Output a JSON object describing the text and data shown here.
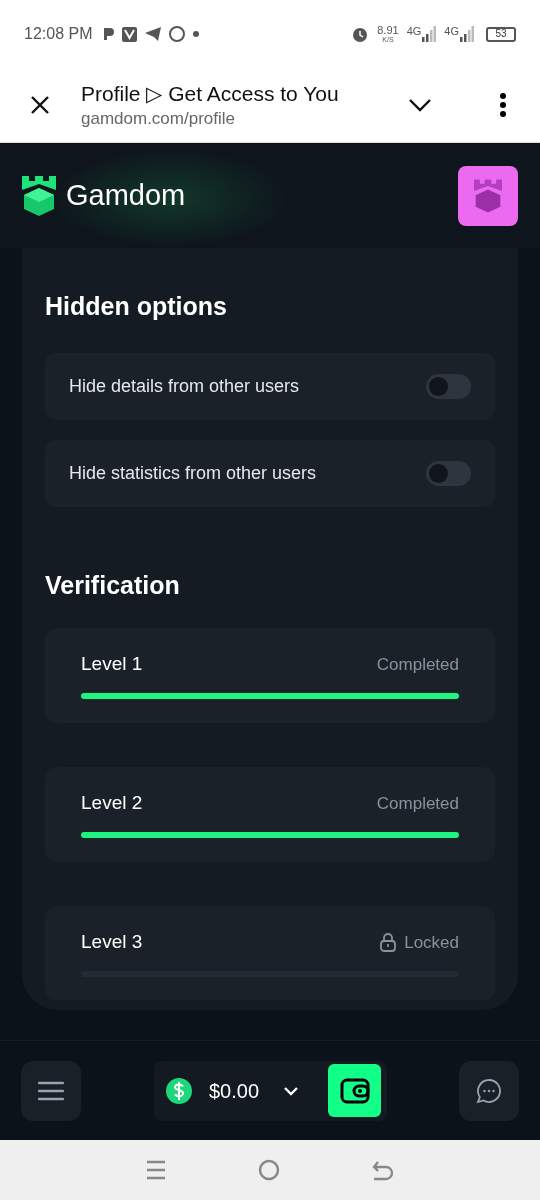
{
  "status_bar": {
    "time": "12:08 PM",
    "speed": "8.91",
    "speed_unit": "K/S",
    "networks": [
      "4G",
      "4G"
    ],
    "battery": "53"
  },
  "browser": {
    "title": "Profile ▷ Get Access to You",
    "url": "gamdom.com/profile"
  },
  "site": {
    "logo": "Gamdom"
  },
  "hidden_options": {
    "title": "Hidden options",
    "toggles": [
      {
        "label": "Hide details from other users",
        "on": false
      },
      {
        "label": "Hide statistics from other users",
        "on": false
      }
    ]
  },
  "verification": {
    "title": "Verification",
    "levels": [
      {
        "name": "Level 1",
        "status": "Completed",
        "locked": false,
        "level": 1
      },
      {
        "name": "Level 2",
        "status": "Completed",
        "locked": false,
        "level": 1
      },
      {
        "name": "Level 3",
        "status": "Locked",
        "locked": true,
        "level": 0
      }
    ]
  },
  "bottom_bar": {
    "balance": "$0.00"
  }
}
